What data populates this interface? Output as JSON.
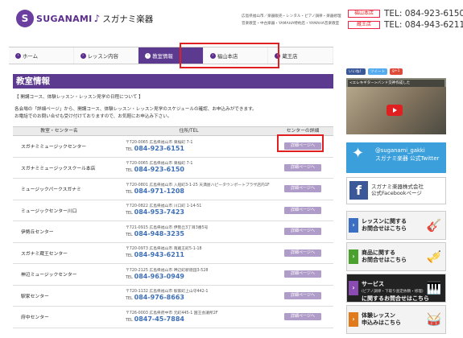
{
  "header": {
    "logo_mark": "S",
    "logo_text": "SUGANAMI",
    "logo_note": "♪",
    "logo_jp": "スガナミ楽器",
    "info_line1": "広島県福山市／楽器販売・レンタル・ピアノ調律・楽器修理",
    "info_line2": "音楽教室・中古楽器・YAMAHA特約店・YAMAHA音楽教室",
    "stores": [
      {
        "name": "福山本店",
        "tel": "TEL: 084-923-6150"
      },
      {
        "name": "蔵王店",
        "tel": "TEL: 084-943-6211"
      }
    ]
  },
  "nav": {
    "items": [
      {
        "label": "ホーム",
        "active": false
      },
      {
        "label": "レッスン内容",
        "active": false
      },
      {
        "label": "教室情報",
        "active": true
      },
      {
        "label": "福山本店",
        "active": false
      },
      {
        "label": "蔵王店",
        "active": false
      }
    ]
  },
  "page": {
    "title": "教室情報",
    "intro_heading": "【 開講コース、体験レッスン・レッスン見学の日程について 】",
    "intro_line1": "各会場の「詳細ページ」から、開講コース、体験レッスン・レッスン見学のスケジュールの確認、お申込みができます。",
    "intro_line2": "お電話でのお問い合せも受け付けておりますので、お気軽にお申込み下さい。"
  },
  "table": {
    "headers": [
      "教室・センター名",
      "住所/TEL",
      "センターの詳細"
    ],
    "tel_label": "TEL",
    "detail_label": "詳細ページへ",
    "rows": [
      {
        "name": "スガナミミュージックセンター",
        "address": "〒720-0065 広島県福山市 東桜町 7-1",
        "tel": "084-923-6151"
      },
      {
        "name": "スガナミミュージックスクール本店",
        "address": "〒720-0065 広島県福山市 東桜町 7-1",
        "tel": "084-923-6150"
      },
      {
        "name": "ミュージックパークスガナミ",
        "address": "〒720-0801 広島県福山市 入船町3-1-25 天満屋ハピータウンポートプラザ店内1F",
        "tel": "084-971-1208"
      },
      {
        "name": "ミュージックセンター川口",
        "address": "〒720-0822 広島県福山市 川口町 1-14-51",
        "tel": "084-953-7423"
      },
      {
        "name": "伊勢丘センター",
        "address": "〒721-0915 広島県福山市 伊勢丘3丁目3番5号",
        "tel": "084-948-3235"
      },
      {
        "name": "スガナミ蔵王センター",
        "address": "〒720-0973 広島県福山市 南蔵王町5-1-18",
        "tel": "084-943-6211"
      },
      {
        "name": "神辺ミュージックセンター",
        "address": "〒720-2125 広島県福山市 神辺町新徳田3-528",
        "tel": "084-963-0949"
      },
      {
        "name": "駅家センター",
        "address": "〒720-1132 広島県福山市 駅家町上山守442-1",
        "tel": "084-976-8663"
      },
      {
        "name": "府中センター",
        "address": "〒726-0003 広島県府中市 元町445-1 国王会議所2F",
        "tel": "0847-45-7884"
      }
    ]
  },
  "sidebar": {
    "share": [
      "いいね！",
      "ツイート",
      "g+1"
    ],
    "video_title": "<エレキギター>バンド交神作成した",
    "twitter_handle": "@suganami_gakki",
    "twitter_sub": "スガナミ楽器 公式Twitter",
    "fb_name": "スガナミ楽器株式会社",
    "fb_sub": "公式Facebookページ",
    "banners": [
      {
        "line1": "レッスンに関する",
        "line2": "お問合せはこちら",
        "line3": "",
        "color": "#3a6fc4"
      },
      {
        "line1": "商品に関する",
        "line2": "お問合せはこちら",
        "line3": "",
        "color": "#4aa12e"
      },
      {
        "line1": "サービス",
        "line2": "(ピアノ調律・下取り査定依頼・修理)",
        "line3": "に関するお問合せはこちら",
        "color": "#8a4bb3"
      },
      {
        "line1": "体験レッスン",
        "line2": "申込みはこちら",
        "line3": "",
        "color": "#e07a1a"
      }
    ]
  }
}
